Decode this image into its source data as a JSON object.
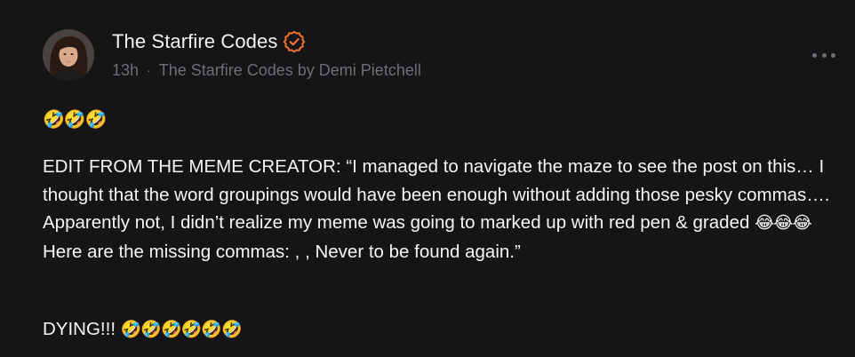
{
  "post": {
    "author": {
      "name": "The Starfire Codes",
      "verified": true,
      "verified_color": "#f0702d"
    },
    "meta": {
      "time": "13h",
      "separator": "·",
      "source": "The Starfire Codes by Demi Pietchell"
    },
    "more_icon": "more-horizontal-icon",
    "emoji_line": "🤣🤣🤣",
    "body_before_emoji": "EDIT FROM THE MEME CREATOR: “I managed to navigate the maze to see the post on this… I thought that the word groupings would have been enough without adding those pesky commas…. Apparently not, I didn’t realize  my meme was going to marked up with red pen & graded ",
    "body_emoji": "😂😂😂",
    "body_after_emoji": " Here are the missing commas: , ,   Never to be found again.”",
    "dying_text": "DYING!!! ",
    "dying_emoji": "🤣🤣🤣🤣🤣🤣"
  },
  "colors": {
    "background": "#151517",
    "text": "#f5f5f5",
    "muted": "#6e6e73",
    "accent": "#f0702d"
  }
}
